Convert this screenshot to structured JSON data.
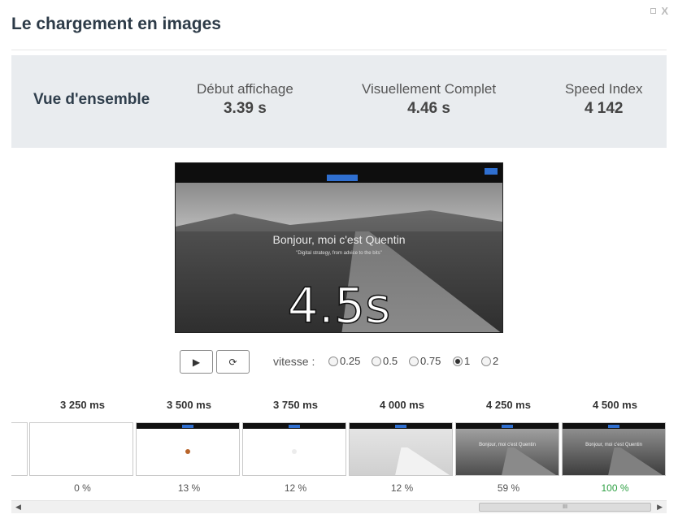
{
  "window": {
    "title": "Le chargement en images",
    "close_label": "X"
  },
  "summary": {
    "title": "Vue d'ensemble",
    "metrics": [
      {
        "label": "Début affichage",
        "value": "3.39 s"
      },
      {
        "label": "Visuellement Complet",
        "value": "4.46 s"
      },
      {
        "label": "Speed Index",
        "value": "4 142"
      }
    ]
  },
  "video": {
    "heading": "Bonjour, moi c'est Quentin",
    "subheading": "\"Digital strategy, from advice to the bits\"",
    "timer": "4.5s"
  },
  "controls": {
    "play_icon": "play-icon",
    "replay_icon": "replay-icon",
    "play_glyph": "▶",
    "replay_glyph": "⟳",
    "speed_label": "vitesse :",
    "speed_options": [
      "0.25",
      "0.5",
      "0.75",
      "1",
      "2"
    ],
    "speed_selected": "1"
  },
  "filmstrip": {
    "frames": [
      {
        "time": "",
        "percent": "0 %",
        "style": "blank"
      },
      {
        "time": "3 250 ms",
        "percent": "13 %",
        "style": "dot-orange"
      },
      {
        "time": "3 500 ms",
        "percent": "12 %",
        "style": "dot-faint"
      },
      {
        "time": "3 750 ms",
        "percent": "12 %",
        "style": "light-road"
      },
      {
        "time": "4 000 ms",
        "percent": "59 %",
        "style": "road"
      },
      {
        "time": "4 250 ms",
        "percent": "100 %",
        "style": "road"
      },
      {
        "time": "4 500 ms",
        "percent": "",
        "style": "none"
      }
    ],
    "frame_text": "Bonjour, moi c'est Quentin"
  },
  "scrollbar": {
    "grip": "III",
    "left_arrow": "◀",
    "right_arrow": "▶"
  },
  "colors": {
    "complete": "#2ea043",
    "accent_blue": "#2f6fd0"
  }
}
